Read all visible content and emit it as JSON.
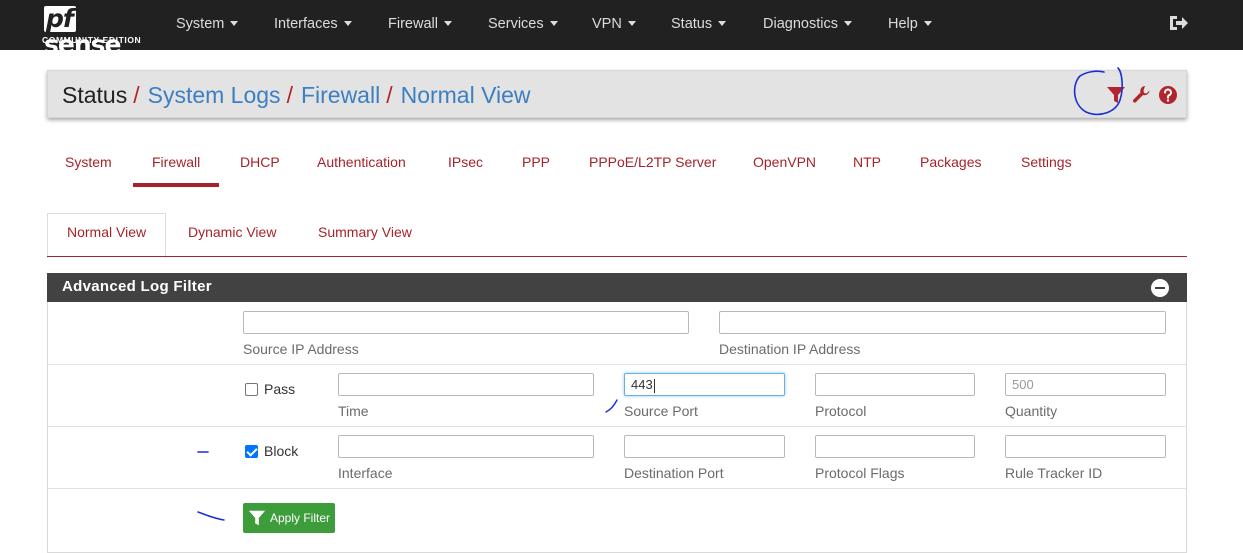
{
  "brand": {
    "logo_pf": "pf",
    "logo_sense": "sense",
    "logo_edition": "COMMUNITY EDITION"
  },
  "nav": {
    "items": [
      {
        "label": "System"
      },
      {
        "label": "Interfaces"
      },
      {
        "label": "Firewall"
      },
      {
        "label": "Services"
      },
      {
        "label": "VPN"
      },
      {
        "label": "Status"
      },
      {
        "label": "Diagnostics"
      },
      {
        "label": "Help"
      }
    ],
    "logout_icon": "sign-out-icon"
  },
  "breadcrumb": {
    "root": "Status",
    "items": [
      "System Logs",
      "Firewall",
      "Normal View"
    ],
    "separator": "/",
    "icons": [
      "filter-icon",
      "wrench-icon",
      "help-icon"
    ]
  },
  "log_tabs": {
    "items": [
      "System",
      "Firewall",
      "DHCP",
      "Authentication",
      "IPsec",
      "PPP",
      "PPPoE/L2TP Server",
      "OpenVPN",
      "NTP",
      "Packages",
      "Settings"
    ],
    "active": "Firewall"
  },
  "view_tabs": {
    "items": [
      "Normal View",
      "Dynamic View",
      "Summary View"
    ],
    "active": "Normal View"
  },
  "filter_panel": {
    "title": "Advanced Log Filter",
    "fields": {
      "source_ip": {
        "label": "Source IP Address",
        "value": ""
      },
      "destination_ip": {
        "label": "Destination IP Address",
        "value": ""
      },
      "time": {
        "label": "Time",
        "value": ""
      },
      "source_port": {
        "label": "Source Port",
        "value": "443"
      },
      "protocol": {
        "label": "Protocol",
        "value": ""
      },
      "quantity": {
        "label": "Quantity",
        "placeholder": "500"
      },
      "interface": {
        "label": "Interface",
        "value": ""
      },
      "destination_port": {
        "label": "Destination Port",
        "value": ""
      },
      "protocol_flags": {
        "label": "Protocol Flags",
        "value": ""
      },
      "rule_tracker_id": {
        "label": "Rule Tracker ID",
        "value": ""
      }
    },
    "pass": {
      "label": "Pass",
      "checked": false
    },
    "block": {
      "label": "Block",
      "checked": true
    },
    "apply_button": "Apply Filter"
  },
  "colors": {
    "navbar": "#212121",
    "accent_red": "#a5242b",
    "link_blue": "#3c7fc2",
    "apply_green": "#3d9d3b",
    "annotation_blue": "#1a2fd6"
  }
}
